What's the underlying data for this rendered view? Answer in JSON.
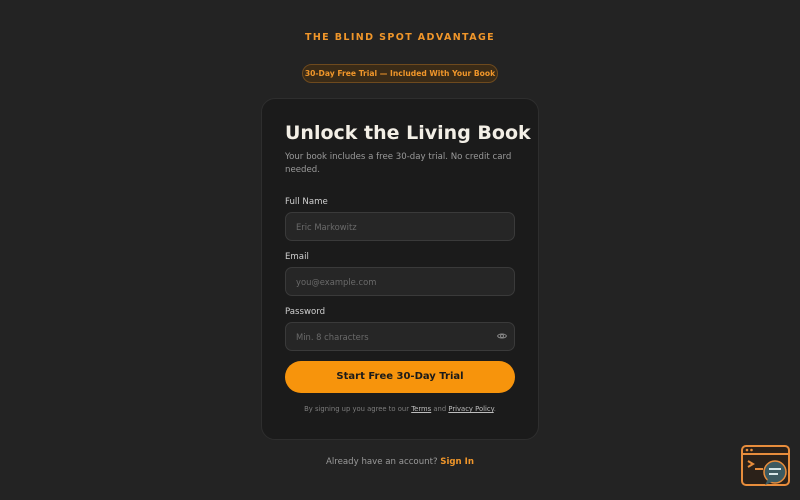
{
  "brand": {
    "title": "THE BLIND SPOT ADVANTAGE"
  },
  "badge": {
    "text": "30-Day Free Trial — Included With Your Book"
  },
  "card": {
    "title": "Unlock the Living Book",
    "subtitle": "Your book includes a free 30-day trial. No credit card needed."
  },
  "form": {
    "name_label": "Full Name",
    "name_placeholder": "Eric Markowitz",
    "name_value": "",
    "email_label": "Email",
    "email_placeholder": "you@example.com",
    "email_value": "",
    "password_label": "Password",
    "password_placeholder": "Min. 8 characters",
    "password_value": "",
    "submit_label": "Start Free 30-Day Trial"
  },
  "legal": {
    "prefix": "By signing up you agree to our",
    "terms": "Terms",
    "and": "and",
    "privacy": "Privacy Policy",
    "suffix": "."
  },
  "footer": {
    "prompt": "Already have an account?",
    "signin": "Sign In"
  },
  "icons": {
    "password_toggle": "eye-icon",
    "widget": "terminal-chat-icon"
  },
  "colors": {
    "background": "#232323",
    "card": "#1b1b1b",
    "accent": "#f7940c",
    "brand": "#f0962a"
  }
}
